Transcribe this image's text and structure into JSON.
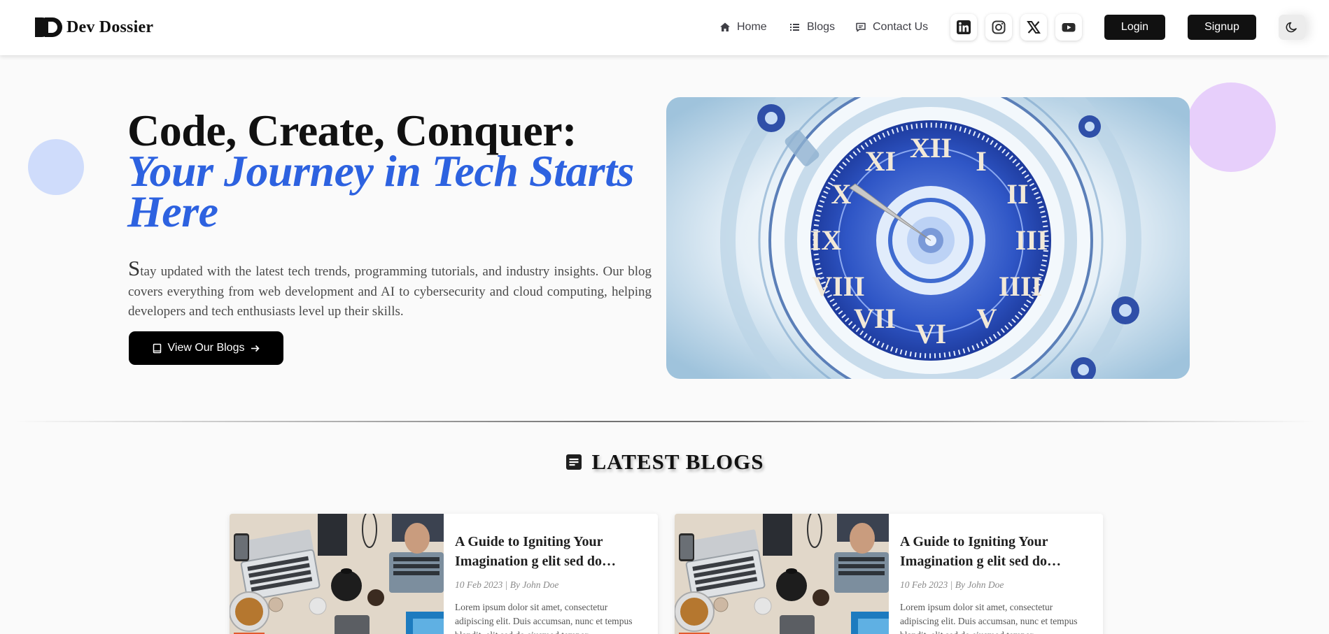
{
  "navbar": {
    "brand": "Dev Dossier",
    "links": [
      {
        "label": "Home",
        "icon": "home-icon"
      },
      {
        "label": "Blogs",
        "icon": "list-icon"
      },
      {
        "label": "Contact Us",
        "icon": "message-icon"
      }
    ],
    "socials": [
      "linkedin-icon",
      "instagram-icon",
      "x-icon",
      "youtube-icon"
    ],
    "login_label": "Login",
    "signup_label": "Signup",
    "theme_icon": "moon-icon"
  },
  "hero": {
    "title_plain": "Code, Create, Conquer: ",
    "title_accent": "Your Journey in Tech Starts Here",
    "description": "Stay updated with the latest tech trends, programming tutorials, and industry insights. Our blog covers everything from web development and AI to cybersecurity and cloud computing, helping developers and tech enthusiasts level up their skills.",
    "cta_label": "View Our Blogs",
    "accent_color": "#2d62e0"
  },
  "latest": {
    "title": "LATEST BLOGS",
    "cards": [
      {
        "title": "A Guide to Igniting Your Imagination g elit sed do eiusmod",
        "meta": "10 Feb 2023 | By John Doe",
        "excerpt": "Lorem ipsum dolor sit amet, consectetur adipiscing elit. Duis accumsan, nunc et tempus blandit, elit sed do eiusmod tempor"
      },
      {
        "title": "A Guide to Igniting Your Imagination g elit sed do eiusmod",
        "meta": "10 Feb 2023 | By John Doe",
        "excerpt": "Lorem ipsum dolor sit amet, consectetur adipiscing elit. Duis accumsan, nunc et tempus blandit, elit sed do eiusmod tempor"
      }
    ]
  }
}
